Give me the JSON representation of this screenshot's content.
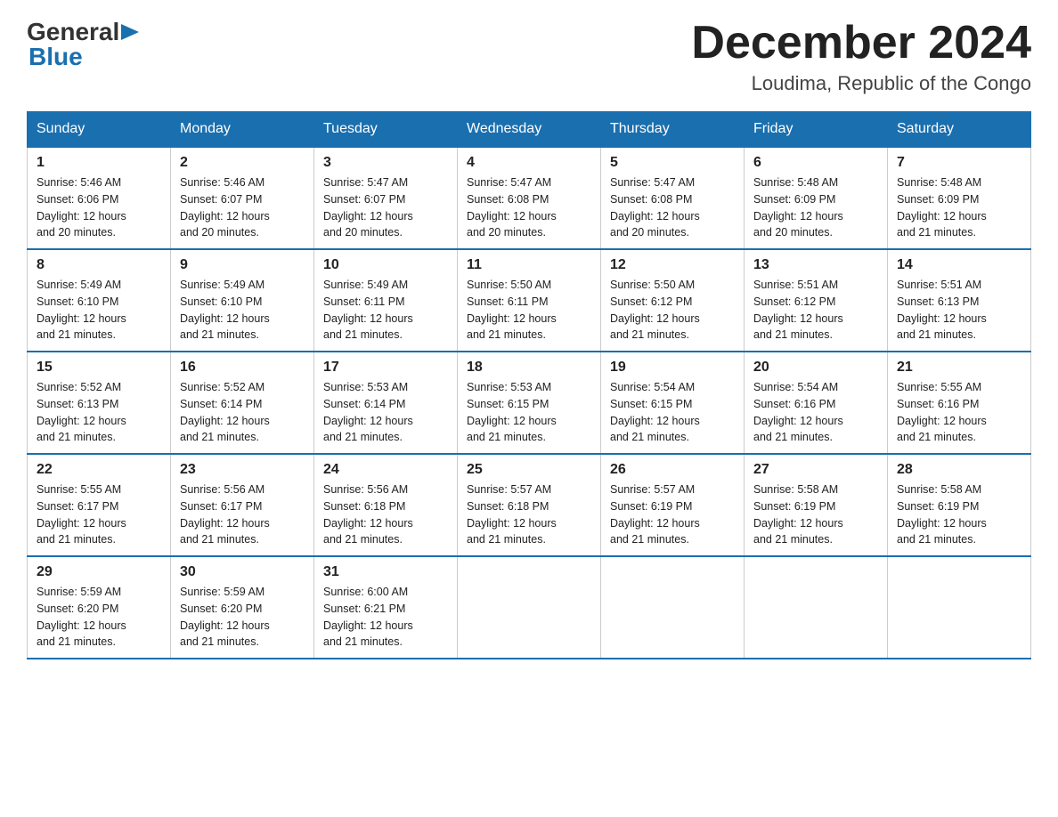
{
  "header": {
    "logo_general": "General",
    "logo_blue": "Blue",
    "month": "December 2024",
    "location": "Loudima, Republic of the Congo"
  },
  "days_of_week": [
    "Sunday",
    "Monday",
    "Tuesday",
    "Wednesday",
    "Thursday",
    "Friday",
    "Saturday"
  ],
  "weeks": [
    [
      {
        "day": "1",
        "sunrise": "5:46 AM",
        "sunset": "6:06 PM",
        "daylight": "12 hours and 20 minutes."
      },
      {
        "day": "2",
        "sunrise": "5:46 AM",
        "sunset": "6:07 PM",
        "daylight": "12 hours and 20 minutes."
      },
      {
        "day": "3",
        "sunrise": "5:47 AM",
        "sunset": "6:07 PM",
        "daylight": "12 hours and 20 minutes."
      },
      {
        "day": "4",
        "sunrise": "5:47 AM",
        "sunset": "6:08 PM",
        "daylight": "12 hours and 20 minutes."
      },
      {
        "day": "5",
        "sunrise": "5:47 AM",
        "sunset": "6:08 PM",
        "daylight": "12 hours and 20 minutes."
      },
      {
        "day": "6",
        "sunrise": "5:48 AM",
        "sunset": "6:09 PM",
        "daylight": "12 hours and 20 minutes."
      },
      {
        "day": "7",
        "sunrise": "5:48 AM",
        "sunset": "6:09 PM",
        "daylight": "12 hours and 21 minutes."
      }
    ],
    [
      {
        "day": "8",
        "sunrise": "5:49 AM",
        "sunset": "6:10 PM",
        "daylight": "12 hours and 21 minutes."
      },
      {
        "day": "9",
        "sunrise": "5:49 AM",
        "sunset": "6:10 PM",
        "daylight": "12 hours and 21 minutes."
      },
      {
        "day": "10",
        "sunrise": "5:49 AM",
        "sunset": "6:11 PM",
        "daylight": "12 hours and 21 minutes."
      },
      {
        "day": "11",
        "sunrise": "5:50 AM",
        "sunset": "6:11 PM",
        "daylight": "12 hours and 21 minutes."
      },
      {
        "day": "12",
        "sunrise": "5:50 AM",
        "sunset": "6:12 PM",
        "daylight": "12 hours and 21 minutes."
      },
      {
        "day": "13",
        "sunrise": "5:51 AM",
        "sunset": "6:12 PM",
        "daylight": "12 hours and 21 minutes."
      },
      {
        "day": "14",
        "sunrise": "5:51 AM",
        "sunset": "6:13 PM",
        "daylight": "12 hours and 21 minutes."
      }
    ],
    [
      {
        "day": "15",
        "sunrise": "5:52 AM",
        "sunset": "6:13 PM",
        "daylight": "12 hours and 21 minutes."
      },
      {
        "day": "16",
        "sunrise": "5:52 AM",
        "sunset": "6:14 PM",
        "daylight": "12 hours and 21 minutes."
      },
      {
        "day": "17",
        "sunrise": "5:53 AM",
        "sunset": "6:14 PM",
        "daylight": "12 hours and 21 minutes."
      },
      {
        "day": "18",
        "sunrise": "5:53 AM",
        "sunset": "6:15 PM",
        "daylight": "12 hours and 21 minutes."
      },
      {
        "day": "19",
        "sunrise": "5:54 AM",
        "sunset": "6:15 PM",
        "daylight": "12 hours and 21 minutes."
      },
      {
        "day": "20",
        "sunrise": "5:54 AM",
        "sunset": "6:16 PM",
        "daylight": "12 hours and 21 minutes."
      },
      {
        "day": "21",
        "sunrise": "5:55 AM",
        "sunset": "6:16 PM",
        "daylight": "12 hours and 21 minutes."
      }
    ],
    [
      {
        "day": "22",
        "sunrise": "5:55 AM",
        "sunset": "6:17 PM",
        "daylight": "12 hours and 21 minutes."
      },
      {
        "day": "23",
        "sunrise": "5:56 AM",
        "sunset": "6:17 PM",
        "daylight": "12 hours and 21 minutes."
      },
      {
        "day": "24",
        "sunrise": "5:56 AM",
        "sunset": "6:18 PM",
        "daylight": "12 hours and 21 minutes."
      },
      {
        "day": "25",
        "sunrise": "5:57 AM",
        "sunset": "6:18 PM",
        "daylight": "12 hours and 21 minutes."
      },
      {
        "day": "26",
        "sunrise": "5:57 AM",
        "sunset": "6:19 PM",
        "daylight": "12 hours and 21 minutes."
      },
      {
        "day": "27",
        "sunrise": "5:58 AM",
        "sunset": "6:19 PM",
        "daylight": "12 hours and 21 minutes."
      },
      {
        "day": "28",
        "sunrise": "5:58 AM",
        "sunset": "6:19 PM",
        "daylight": "12 hours and 21 minutes."
      }
    ],
    [
      {
        "day": "29",
        "sunrise": "5:59 AM",
        "sunset": "6:20 PM",
        "daylight": "12 hours and 21 minutes."
      },
      {
        "day": "30",
        "sunrise": "5:59 AM",
        "sunset": "6:20 PM",
        "daylight": "12 hours and 21 minutes."
      },
      {
        "day": "31",
        "sunrise": "6:00 AM",
        "sunset": "6:21 PM",
        "daylight": "12 hours and 21 minutes."
      },
      null,
      null,
      null,
      null
    ]
  ],
  "labels": {
    "sunrise": "Sunrise:",
    "sunset": "Sunset:",
    "daylight": "Daylight:"
  }
}
